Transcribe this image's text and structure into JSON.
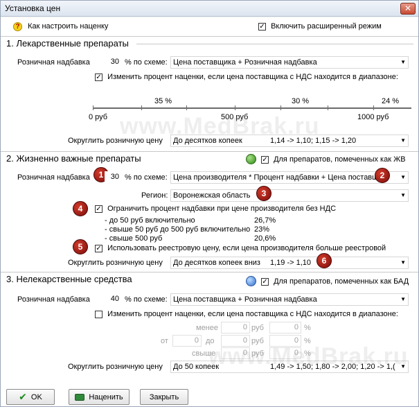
{
  "window": {
    "title": "Установка цен",
    "close_glyph": "✕"
  },
  "top": {
    "help_link": "Как настроить наценку",
    "help_icon": "question-mark-icon",
    "extended_mode_label": "Включить расширенный режим",
    "extended_mode_checked": true
  },
  "section1": {
    "title": "1. Лекарственные препараты",
    "markup_label": "Розничная надбавка",
    "markup_value": "30",
    "percent_scheme_label": "% по схеме:",
    "scheme_value": "Цена поставщика + Розничная надбавка",
    "change_range_label": "Изменить процент наценки, если цена поставщика с НДС находится в диапазоне:",
    "change_range_checked": true,
    "scale": {
      "pcts": [
        "35 %",
        "30 %",
        "24 %"
      ],
      "labels": [
        "0 руб",
        "500 руб",
        "1000 руб"
      ]
    },
    "round_label": "Округлить розничную цену",
    "round_value": "До десятков копеек",
    "round_example": "1,14 -> 1,10;  1,15 -> 1,20"
  },
  "section2": {
    "title": "2. Жизненно важные препараты",
    "status_icon": "green-circle-icon",
    "for_marked_label": "Для препаратов, помеченных как ЖВ",
    "for_marked_checked": true,
    "markup_label": "Розничная надбавка",
    "markup_value": "30",
    "percent_scheme_label": "% по схеме:",
    "scheme_value": "Цена производителя * Процент надбавки + Цена поставщи",
    "region_label": "Регион:",
    "region_value": "Воронежская область",
    "limit_label": "Ограничить процент надбавки при цене производителя без НДС",
    "limit_checked": true,
    "limits": [
      {
        "label": "- до 50 руб  включительно",
        "value": "26,7%"
      },
      {
        "label": "- свыше 50 руб до 500 руб включительно",
        "value": "23%"
      },
      {
        "label": "- свыше 500 руб",
        "value": "20,6%"
      }
    ],
    "registry_label": "Использовать реестровую цену, если цена производителя больше реестровой",
    "registry_checked": true,
    "round_label": "Округлить розничную цену",
    "round_value": "До десятков копеек вниз",
    "round_example": "1,19 -> 1,10",
    "badges": [
      "1",
      "2",
      "3",
      "4",
      "5",
      "6"
    ]
  },
  "section3": {
    "title": "3. Нелекарственные средства",
    "status_icon": "blue-circle-icon",
    "for_marked_label": "Для препаратов, помеченных как БАД",
    "for_marked_checked": true,
    "markup_label": "Розничная надбавка",
    "markup_value": "40",
    "percent_scheme_label": "% по схеме:",
    "scheme_value": "Цена поставщика + Розничная надбавка",
    "change_range_label": "Изменить процент наценки, если цена поставщика с НДС находится в диапазоне:",
    "change_range_checked": false,
    "range_rows": [
      {
        "prefix": "",
        "label1": "менее",
        "v1": "0",
        "unit1": "руб",
        "v2": "0",
        "unit2": "%"
      },
      {
        "prefix": "от",
        "label1": "",
        "v1": "0",
        "mid": "до",
        "v1b": "0",
        "unit1": "руб",
        "v2": "0",
        "unit2": "%"
      },
      {
        "prefix": "",
        "label1": "свыше",
        "v1": "0",
        "unit1": "руб",
        "v2": "0",
        "unit2": "%"
      }
    ],
    "round_label": "Округлить розничную цену",
    "round_value": "До 50 копеек",
    "round_example": "1,49 -> 1,50;  1,80 -> 2,00;  1,20 -> 1,("
  },
  "buttons": {
    "ok": "OK",
    "apply": "Наценить",
    "close": "Закрыть"
  },
  "watermark": "www.MedBrak.ru"
}
